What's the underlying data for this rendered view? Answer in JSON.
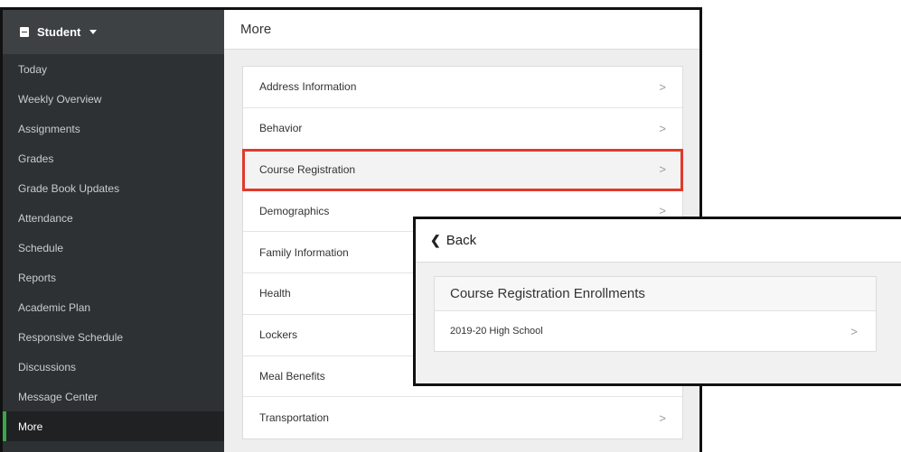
{
  "sidebar": {
    "header_label": "Student",
    "items": [
      {
        "label": "Today"
      },
      {
        "label": "Weekly Overview"
      },
      {
        "label": "Assignments"
      },
      {
        "label": "Grades"
      },
      {
        "label": "Grade Book Updates"
      },
      {
        "label": "Attendance"
      },
      {
        "label": "Schedule"
      },
      {
        "label": "Reports"
      },
      {
        "label": "Academic Plan"
      },
      {
        "label": "Responsive Schedule"
      },
      {
        "label": "Discussions"
      },
      {
        "label": "Message Center"
      },
      {
        "label": "More"
      }
    ],
    "active_item": "More"
  },
  "main": {
    "title": "More",
    "menu": [
      {
        "label": "Address Information",
        "chevron": ">"
      },
      {
        "label": "Behavior",
        "chevron": ">"
      },
      {
        "label": "Course Registration",
        "chevron": ">"
      },
      {
        "label": "Demographics",
        "chevron": ">"
      },
      {
        "label": "Family Information",
        "chevron": ""
      },
      {
        "label": "Health",
        "chevron": ""
      },
      {
        "label": "Lockers",
        "chevron": ""
      },
      {
        "label": "Meal Benefits",
        "chevron": ""
      },
      {
        "label": "Transportation",
        "chevron": ">"
      }
    ],
    "highlight_color": "#e03a2c"
  },
  "popup": {
    "back_label": "Back",
    "card_title": "Course Registration Enrollments",
    "rows": [
      {
        "label": "2019-20 High School",
        "chevron": ">"
      }
    ]
  },
  "colors": {
    "sidebar_bg": "#2e3133",
    "active_accent": "#3aa54b"
  }
}
